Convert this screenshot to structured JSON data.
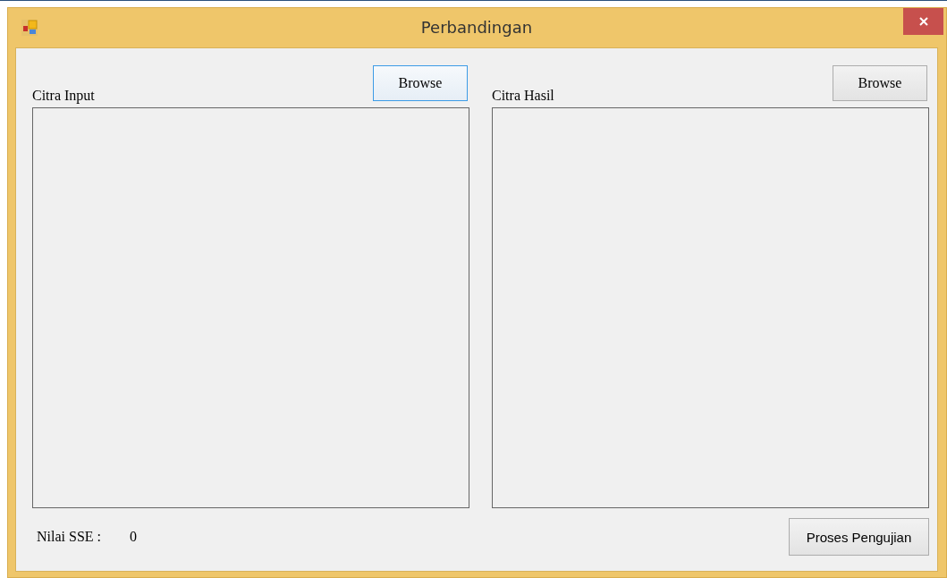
{
  "window": {
    "title": "Perbandingan"
  },
  "panels": [
    {
      "label": "Citra Input",
      "button": {
        "label": "Browse",
        "focused": true
      }
    },
    {
      "label": "Citra Hasil",
      "button": {
        "label": "Browse",
        "focused": false
      }
    }
  ],
  "result": {
    "label": "Nilai SSE :",
    "value": "0"
  },
  "process_button": {
    "label": "Proses Pengujian",
    "focused": false
  }
}
